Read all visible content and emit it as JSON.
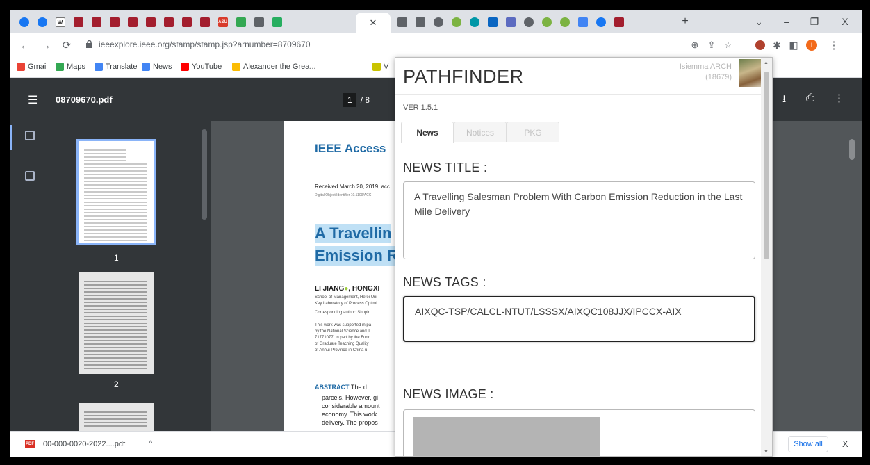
{
  "tabs": {
    "favicons": [
      "#1877f2",
      "#1877f2",
      "#ffffff",
      "#a31e2e",
      "#a31e2e",
      "#a31e2e",
      "#a31e2e",
      "#a31e2e",
      "#a31e2e",
      "#a31e2e",
      "#a31e2e",
      "#d83b2c",
      "#34a853",
      "#5f6368",
      "#27ae60"
    ],
    "favicons_right": [
      "#5f6368",
      "#5f6368",
      "#5f6368",
      "#7cb342",
      "#0097a7",
      "#0a66c2",
      "#5c6bc0",
      "#5f6368",
      "#7cb342",
      "#7cb342",
      "#4285f4",
      "#1877f2",
      "#a31e2e"
    ],
    "new_tab_label": "+",
    "w_label": "W",
    "asu_label": "ASU"
  },
  "window_controls": {
    "minimize": "–",
    "restore": "❐",
    "close": "X",
    "chevron": "⌄"
  },
  "navbar": {
    "url": "ieeexplore.ieee.org/stamp/stamp.jsp?arnumber=8709670"
  },
  "bookmarks": [
    {
      "label": "Gmail",
      "color": "#ea4335"
    },
    {
      "label": "Maps",
      "color": "#34a853"
    },
    {
      "label": "Translate",
      "color": "#4285f4"
    },
    {
      "label": "News",
      "color": "#4285f4"
    },
    {
      "label": "YouTube",
      "color": "#ff0000"
    },
    {
      "label": "Alexander the Grea...",
      "color": "#fbbc04"
    },
    {
      "label": "V",
      "color": "#c9c300"
    }
  ],
  "pdf": {
    "filename": "08709670.pdf",
    "page_current": "1",
    "page_total": "/ 8",
    "thumb_labels": [
      "1",
      "2"
    ],
    "doc": {
      "journal": "IEEE Access",
      "received": "Received March 20, 2019, acc",
      "doi": "Digital Object Identifier 10.1109/ACC",
      "title_line1": "A Travellin",
      "title_line2": "Emission R",
      "authors": "LI JIANG",
      "authors2": ", HONGXI",
      "affil1": "School of Management, Hefei Uni",
      "affil2": "Key Laboratory of Process Optimi",
      "corr": "Corresponding author: Shupin",
      "fund1": "This work was supported in pa",
      "fund2": "by the National Science and T",
      "fund3": "71771077, in part by the Fund",
      "fund4": "of Graduate Teaching Quality",
      "fund5": "of Anhui Province in China u",
      "abstract_head": "ABSTRACT",
      "abstract_tail": "The d",
      "abs1": "parcels. However, gi",
      "abs2": "considerable amount",
      "abs3": "economy. This work",
      "abs4": "delivery. The propos"
    }
  },
  "download": {
    "filename": "00-000-0020-2022....pdf",
    "show_all": "Show all",
    "close": "X"
  },
  "popup": {
    "title": "PATHFINDER",
    "user_name": "Isiemma ARCH",
    "user_id": "(18679)",
    "version": "VER 1.5.1",
    "tabs": [
      "News",
      "Notices",
      "PKG"
    ],
    "news_title_label": "NEWS TITLE :",
    "news_title_value": "A Travelling Salesman Problem With Carbon Emission Reduction in the Last Mile Delivery",
    "news_tags_label": "NEWS TAGS :",
    "news_tags_value": "AIXQC-TSP/CALCL-NTUT/LSSSX/AIXQC108JJX/IPCCX-AIX",
    "news_image_label": "NEWS IMAGE :"
  }
}
